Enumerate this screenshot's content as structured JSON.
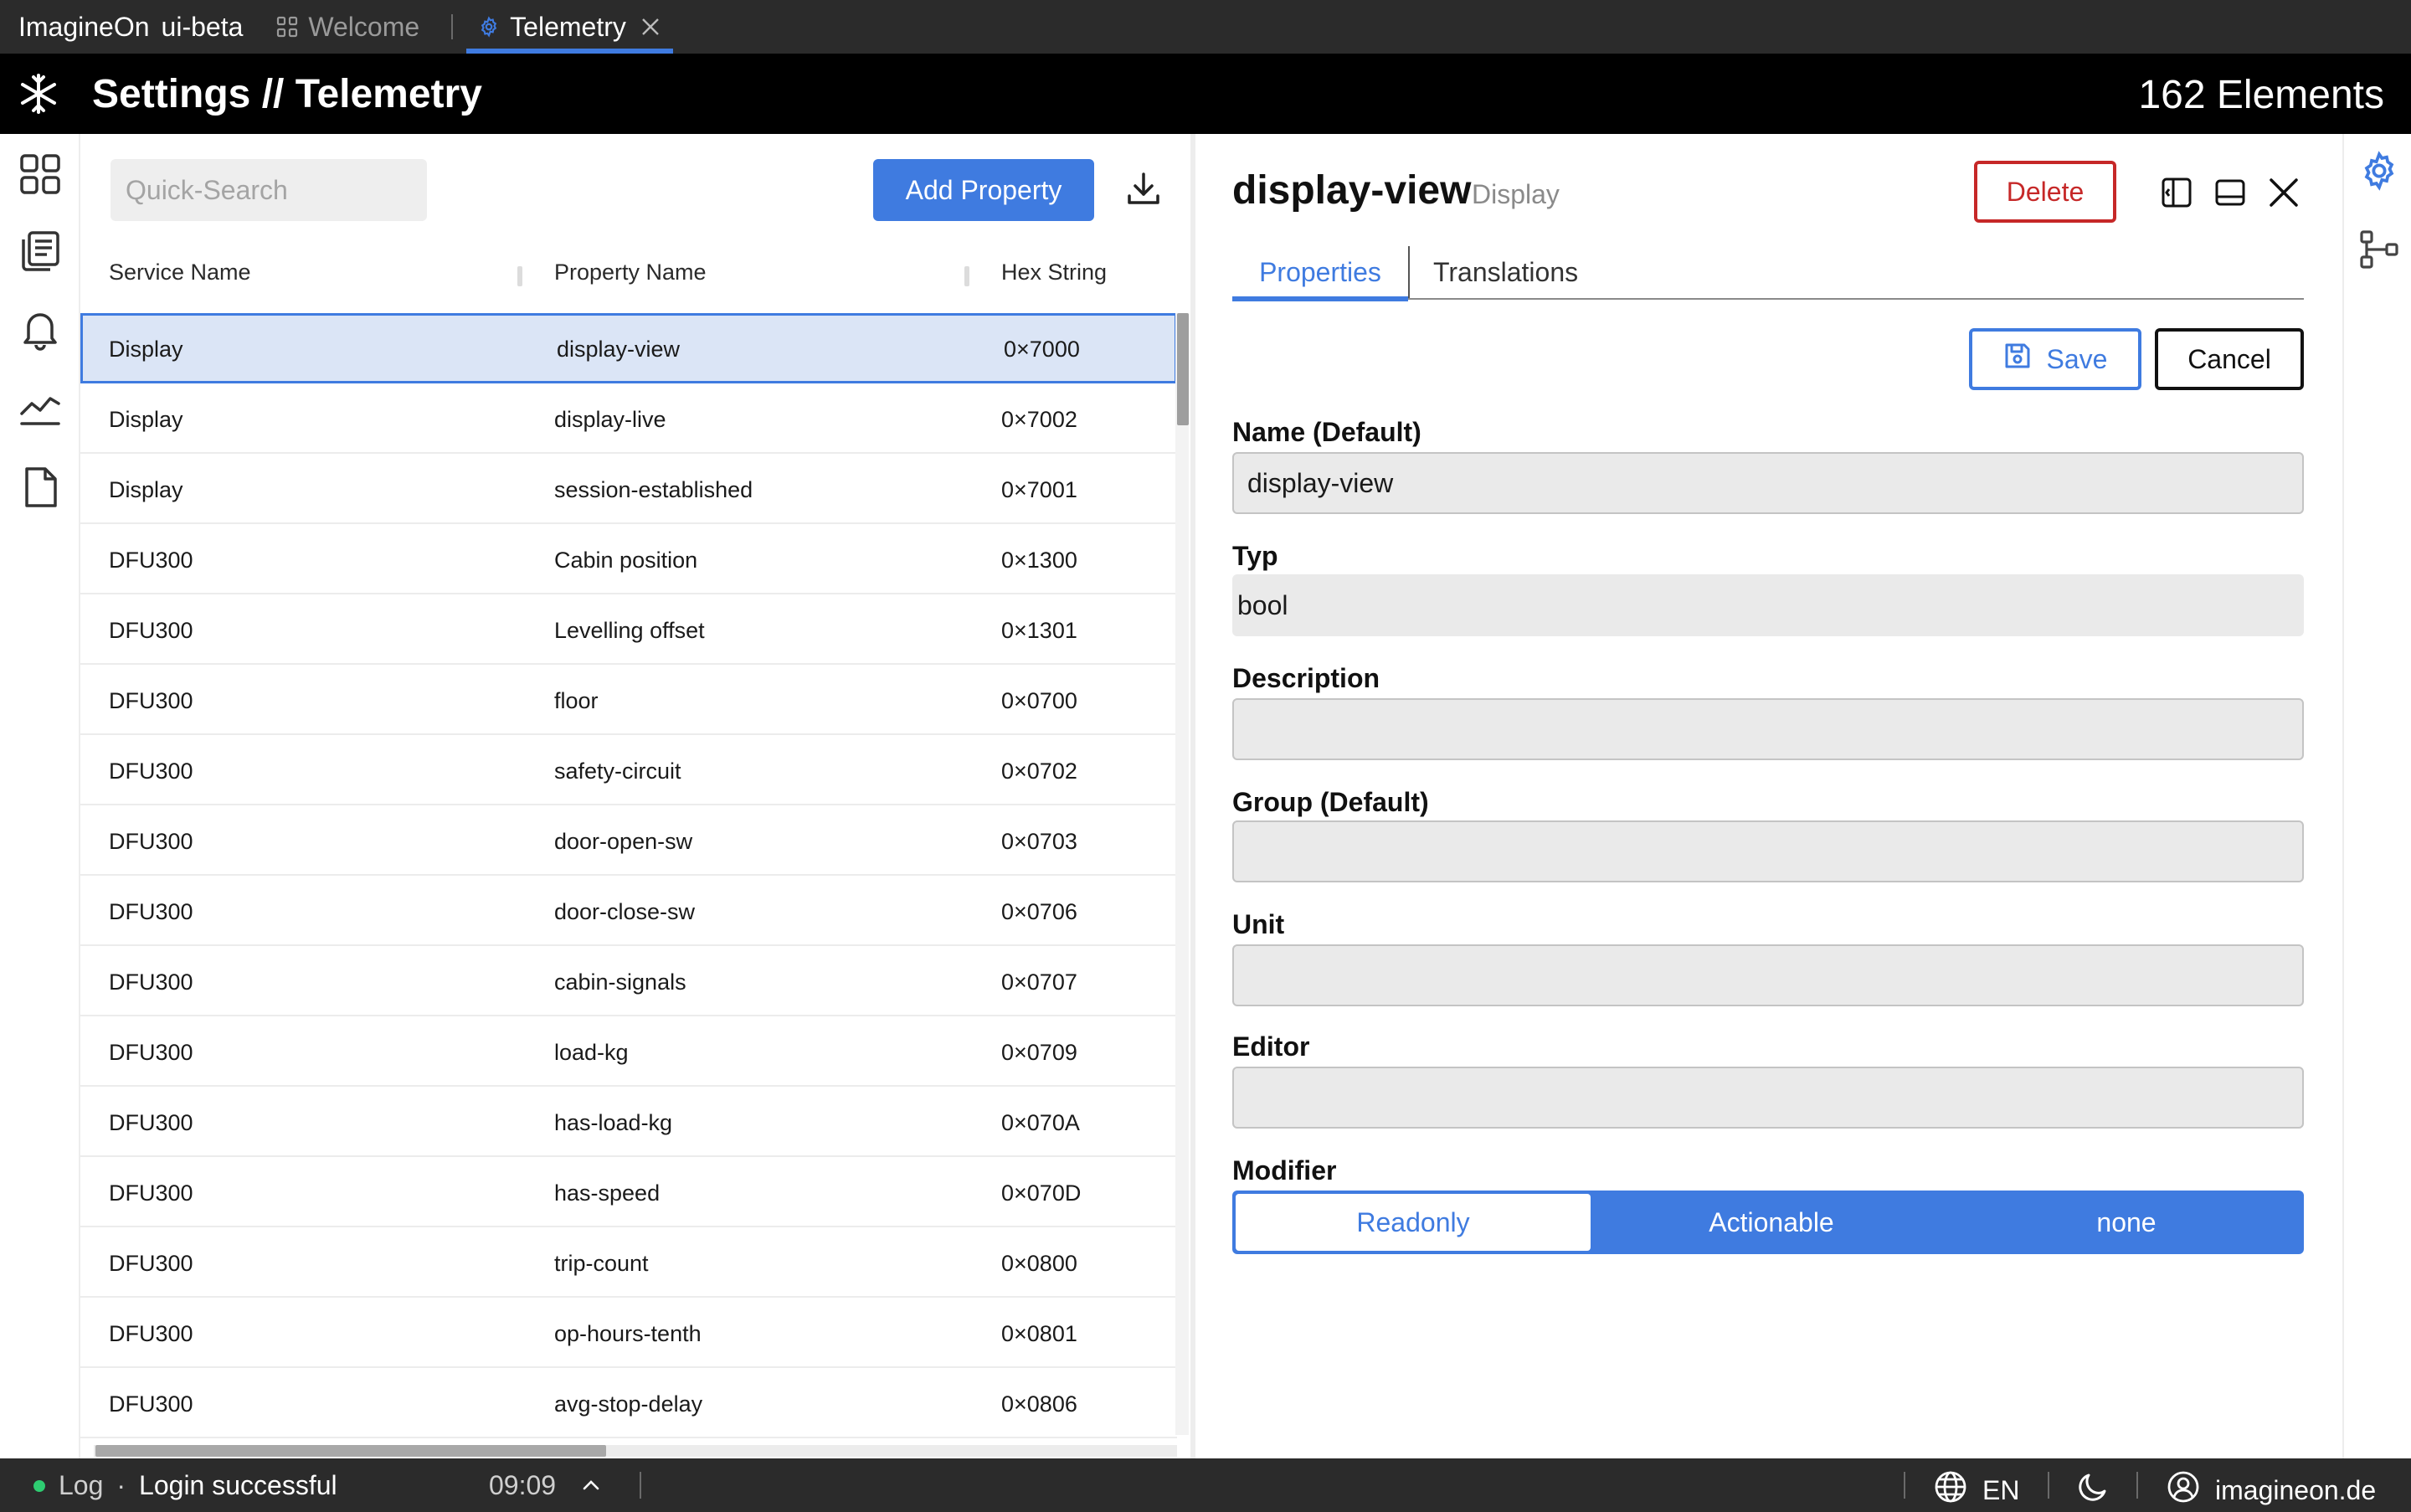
{
  "tabbar": {
    "app_name": "ImagineOn",
    "app_badge": "ui-beta",
    "tabs": [
      {
        "label": "Welcome",
        "icon": "grid-icon"
      },
      {
        "label": "Telemetry",
        "icon": "gear-icon",
        "active": true
      }
    ]
  },
  "header": {
    "title": "Settings // Telemetry",
    "count": "162 Elements"
  },
  "rail": [
    "dashboard-icon",
    "documents-icon",
    "bell-icon",
    "chart-icon",
    "file-icon"
  ],
  "list": {
    "search_placeholder": "Quick-Search",
    "add_label": "Add Property",
    "columns": [
      "Service Name",
      "Property Name",
      "Hex String"
    ],
    "rows": [
      {
        "service": "Display",
        "property": "display-view",
        "hex": "0×7000",
        "selected": true
      },
      {
        "service": "Display",
        "property": "display-live",
        "hex": "0×7002"
      },
      {
        "service": "Display",
        "property": "session-established",
        "hex": "0×7001"
      },
      {
        "service": "DFU300",
        "property": "Cabin position",
        "hex": "0×1300"
      },
      {
        "service": "DFU300",
        "property": "Levelling offset",
        "hex": "0×1301"
      },
      {
        "service": "DFU300",
        "property": "floor",
        "hex": "0×0700"
      },
      {
        "service": "DFU300",
        "property": "safety-circuit",
        "hex": "0×0702"
      },
      {
        "service": "DFU300",
        "property": "door-open-sw",
        "hex": "0×0703"
      },
      {
        "service": "DFU300",
        "property": "door-close-sw",
        "hex": "0×0706"
      },
      {
        "service": "DFU300",
        "property": "cabin-signals",
        "hex": "0×0707"
      },
      {
        "service": "DFU300",
        "property": "load-kg",
        "hex": "0×0709"
      },
      {
        "service": "DFU300",
        "property": "has-load-kg",
        "hex": "0×070A"
      },
      {
        "service": "DFU300",
        "property": "has-speed",
        "hex": "0×070D"
      },
      {
        "service": "DFU300",
        "property": "trip-count",
        "hex": "0×0800"
      },
      {
        "service": "DFU300",
        "property": "op-hours-tenth",
        "hex": "0×0801"
      },
      {
        "service": "DFU300",
        "property": "avg-stop-delay",
        "hex": "0×0806"
      }
    ]
  },
  "detail": {
    "title": "display-view",
    "subtitle": "Display",
    "delete_label": "Delete",
    "tabs": [
      "Properties",
      "Translations"
    ],
    "save_label": "Save",
    "cancel_label": "Cancel",
    "fields": {
      "name": {
        "label": "Name (Default)",
        "value": "display-view"
      },
      "typ": {
        "label": "Typ",
        "value": "bool"
      },
      "description": {
        "label": "Description",
        "value": ""
      },
      "group": {
        "label": "Group (Default)",
        "value": ""
      },
      "unit": {
        "label": "Unit",
        "value": ""
      },
      "editor": {
        "label": "Editor",
        "value": ""
      }
    },
    "modifier": {
      "label": "Modifier",
      "options": [
        "Readonly",
        "Actionable",
        "none"
      ],
      "selected": "Readonly"
    }
  },
  "right_rail": [
    "settings-icon",
    "hierarchy-icon"
  ],
  "status": {
    "log_label": "Log",
    "message": "Login successful",
    "time": "09:09",
    "language": "EN",
    "account": "imagineon.de"
  },
  "colors": {
    "accent": "#3f7be0",
    "danger": "#c62828",
    "selected_row": "#dbe5f6",
    "success": "#2ecc71"
  }
}
